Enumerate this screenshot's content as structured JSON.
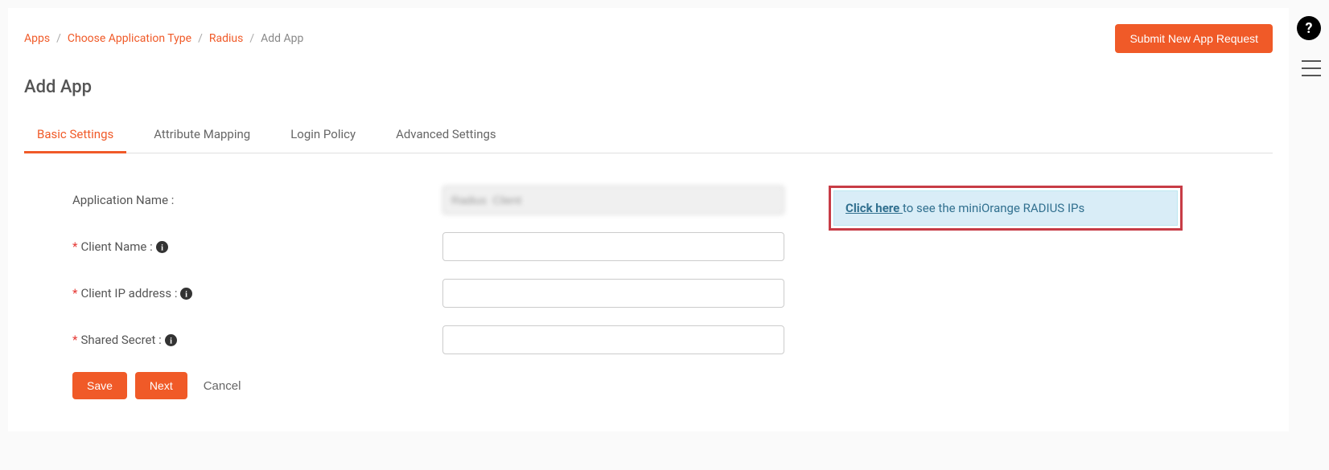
{
  "breadcrumb": {
    "items": [
      "Apps",
      "Choose Application Type",
      "Radius"
    ],
    "current": "Add App"
  },
  "header": {
    "submit_button": "Submit New App Request",
    "page_title": "Add App"
  },
  "tabs": [
    {
      "label": "Basic Settings",
      "active": true
    },
    {
      "label": "Attribute Mapping",
      "active": false
    },
    {
      "label": "Login Policy",
      "active": false
    },
    {
      "label": "Advanced Settings",
      "active": false
    }
  ],
  "form": {
    "app_name_label": "Application Name :",
    "app_name_value": "Radius  Client",
    "client_name_label": "Client Name :",
    "client_name_value": "",
    "client_ip_label": "Client IP address :",
    "client_ip_value": "",
    "shared_secret_label": "Shared Secret :",
    "shared_secret_value": ""
  },
  "info_box": {
    "link_text": "Click here ",
    "rest_text": "to see the miniOrange RADIUS IPs"
  },
  "buttons": {
    "save": "Save",
    "next": "Next",
    "cancel": "Cancel"
  }
}
